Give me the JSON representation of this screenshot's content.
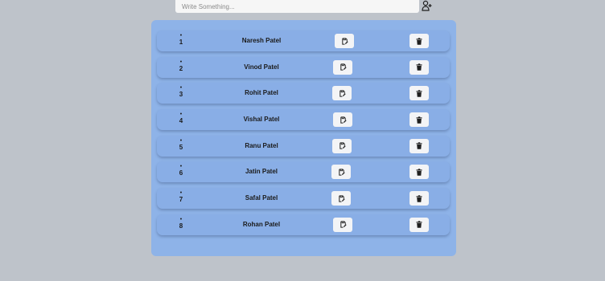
{
  "input": {
    "placeholder": "Write Something...",
    "value": ""
  },
  "add_button": {
    "icon": "add-user-icon"
  },
  "todos": [
    {
      "num": "1",
      "name": "Naresh Patel"
    },
    {
      "num": "2",
      "name": "Vinod Patel"
    },
    {
      "num": "3",
      "name": "Rohit Patel"
    },
    {
      "num": "4",
      "name": "Vishal Patel"
    },
    {
      "num": "5",
      "name": "Ranu Patel"
    },
    {
      "num": "6",
      "name": "Jatin Patel"
    },
    {
      "num": "7",
      "name": "Safal Patel"
    },
    {
      "num": "8",
      "name": "Rohan Patel"
    }
  ],
  "row_icons": {
    "edit": "edit-icon",
    "delete": "trash-icon",
    "bullet": "•"
  },
  "colors": {
    "background": "#bec3ca",
    "panel": "#8eb3e8",
    "row": "#89aee6",
    "button": "#f3f4f6",
    "input": "#f6f6f6"
  }
}
